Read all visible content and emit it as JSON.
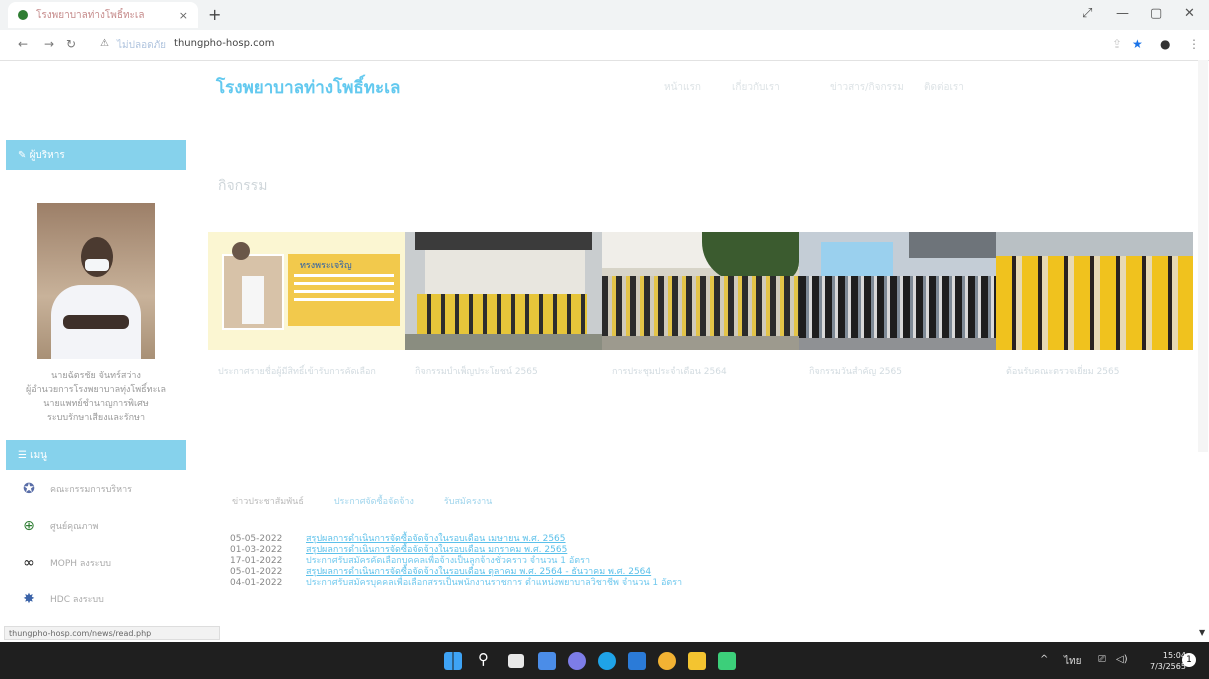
{
  "browser": {
    "tab_title": "โรงพยาบาลท่างโพธิ์ทะเล",
    "tab_close": "×",
    "new_tab": "+",
    "address": {
      "warn": "⚠",
      "badge": "ไม่ปลอดภัย",
      "host": "thungpho-hosp.com"
    }
  },
  "site": {
    "title": "โรงพยาบาลท่างโพธิ์ทะเล",
    "nav": [
      "หน้าแรก",
      "เกี่ยวกับเรา",
      "ข่าวสาร/กิจกรรม",
      "ติดต่อเรา"
    ]
  },
  "sidebar": {
    "director_header": "ผู้บริหาร",
    "director_lines": [
      "นายฉัตรชัย จันทร์สว่าง",
      "ผู้อำนวยการโรงพยาบาลทุ่งโพธิ์ทะเล",
      "นายแพทย์ชำนาญการพิเศษ",
      "ระบบรักษาเสียงและรักษา"
    ],
    "menu_header": "เมนู",
    "menu_items": [
      {
        "icon": "shield-icon",
        "label": "คณะกรรมการบริหาร"
      },
      {
        "icon": "plus-circle-icon",
        "label": "ศูนย์คุณภาพ"
      },
      {
        "icon": "rings-icon",
        "label": "MOPH ลงระบบ"
      },
      {
        "icon": "badge-icon",
        "label": "HDC ลงระบบ"
      }
    ]
  },
  "activities": {
    "title": "กิจกรรม",
    "captions": [
      "ประกาศรายชื่อผู้มีสิทธิ์เข้ารับการคัดเลือก",
      "กิจกรรมบำเพ็ญประโยชน์ 2565",
      "การประชุมประจำเดือน 2564",
      "กิจกรรมวันสำคัญ 2565",
      "ต้อนรับคณะตรวจเยี่ยม 2565"
    ],
    "photo1_caption": "ทรงพระเจริญ"
  },
  "news": {
    "tabs": [
      "ข่าวประชาสัมพันธ์",
      "ประกาศจัดซื้อจัดจ้าง",
      "รับสมัครงาน"
    ],
    "items": [
      {
        "date": "05-05-2022",
        "title": "สรุปผลการดำเนินการจัดซื้อจัดจ้างในรอบเดือน เมษายน พ.ศ. 2565"
      },
      {
        "date": "01-03-2022",
        "title": "สรุปผลการดำเนินการจัดซื้อจัดจ้างในรอบเดือน มกราคม พ.ศ. 2565"
      },
      {
        "date": "17-01-2022",
        "title": "ประกาศรับสมัครคัดเลือกบุคคลเพื่อจ้างเป็นลูกจ้างชั่วคราว จำนวน 1 อัตรา"
      },
      {
        "date": "05-01-2022",
        "title": "สรุปผลการดำเนินการจัดซื้อจัดจ้างในรอบเดือน ตุลาคม พ.ศ. 2564 - ธันวาคม พ.ศ. 2564"
      },
      {
        "date": "04-01-2022",
        "title": "ประกาศรับสมัครบุคคลเพื่อเลือกสรรเป็นพนักงานราชการ ตำแหน่งพยาบาลวิชาชีพ จำนวน 1 อัตรา"
      }
    ]
  },
  "status_url": "thungpho-hosp.com/news/read.php",
  "taskbar": {
    "tray_lang": "ไทย",
    "time": "15:04",
    "date": "7/3/2565",
    "notifications": "1"
  },
  "colors": {
    "accent": "#63c9ef",
    "side_header": "#86d2ec",
    "taskbar": "#1f1f1f"
  }
}
